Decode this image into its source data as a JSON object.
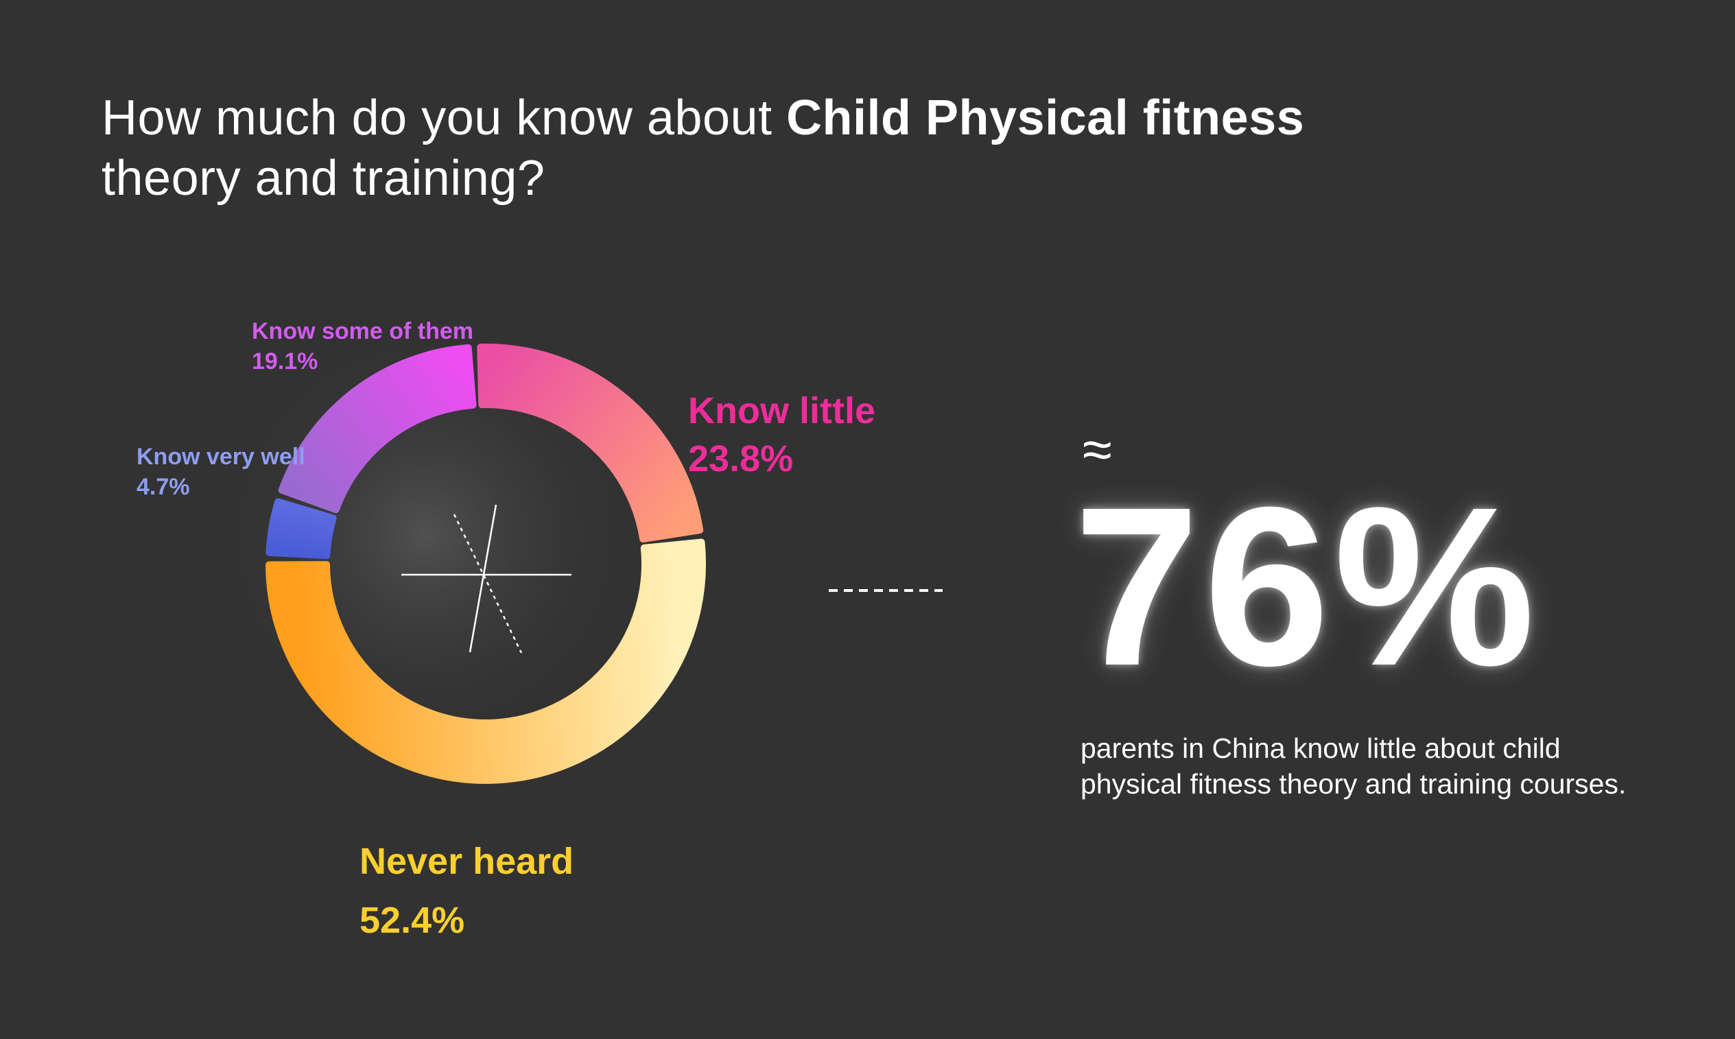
{
  "title": {
    "prefix": "How much do you know about ",
    "bold": "Child Physical fitness",
    "suffix": "theory and training?"
  },
  "chart_data": {
    "type": "pie",
    "categories": [
      "Never heard",
      "Know very well",
      "Know some of them",
      "Know little"
    ],
    "values": [
      52.4,
      4.7,
      19.1,
      23.8
    ],
    "value_labels": [
      "52.4%",
      "4.7%",
      "19.1%",
      "23.8%"
    ],
    "colors": [
      [
        "#fff1b8",
        "#ff9f1c"
      ],
      [
        "#4a5cd6",
        "#5b6be0"
      ],
      [
        "#9a6ad0",
        "#ee4df2"
      ],
      [
        "#ea4fa4",
        "#ff9e78"
      ]
    ],
    "label_colors": [
      "#ffcf2e",
      "#8e9ef2",
      "#d35cf0",
      "#ee2d9a"
    ]
  },
  "summary": {
    "approx_symbol": "≈",
    "big_value": "76%",
    "description": "parents in China know little about child physical fitness theory and training courses."
  }
}
